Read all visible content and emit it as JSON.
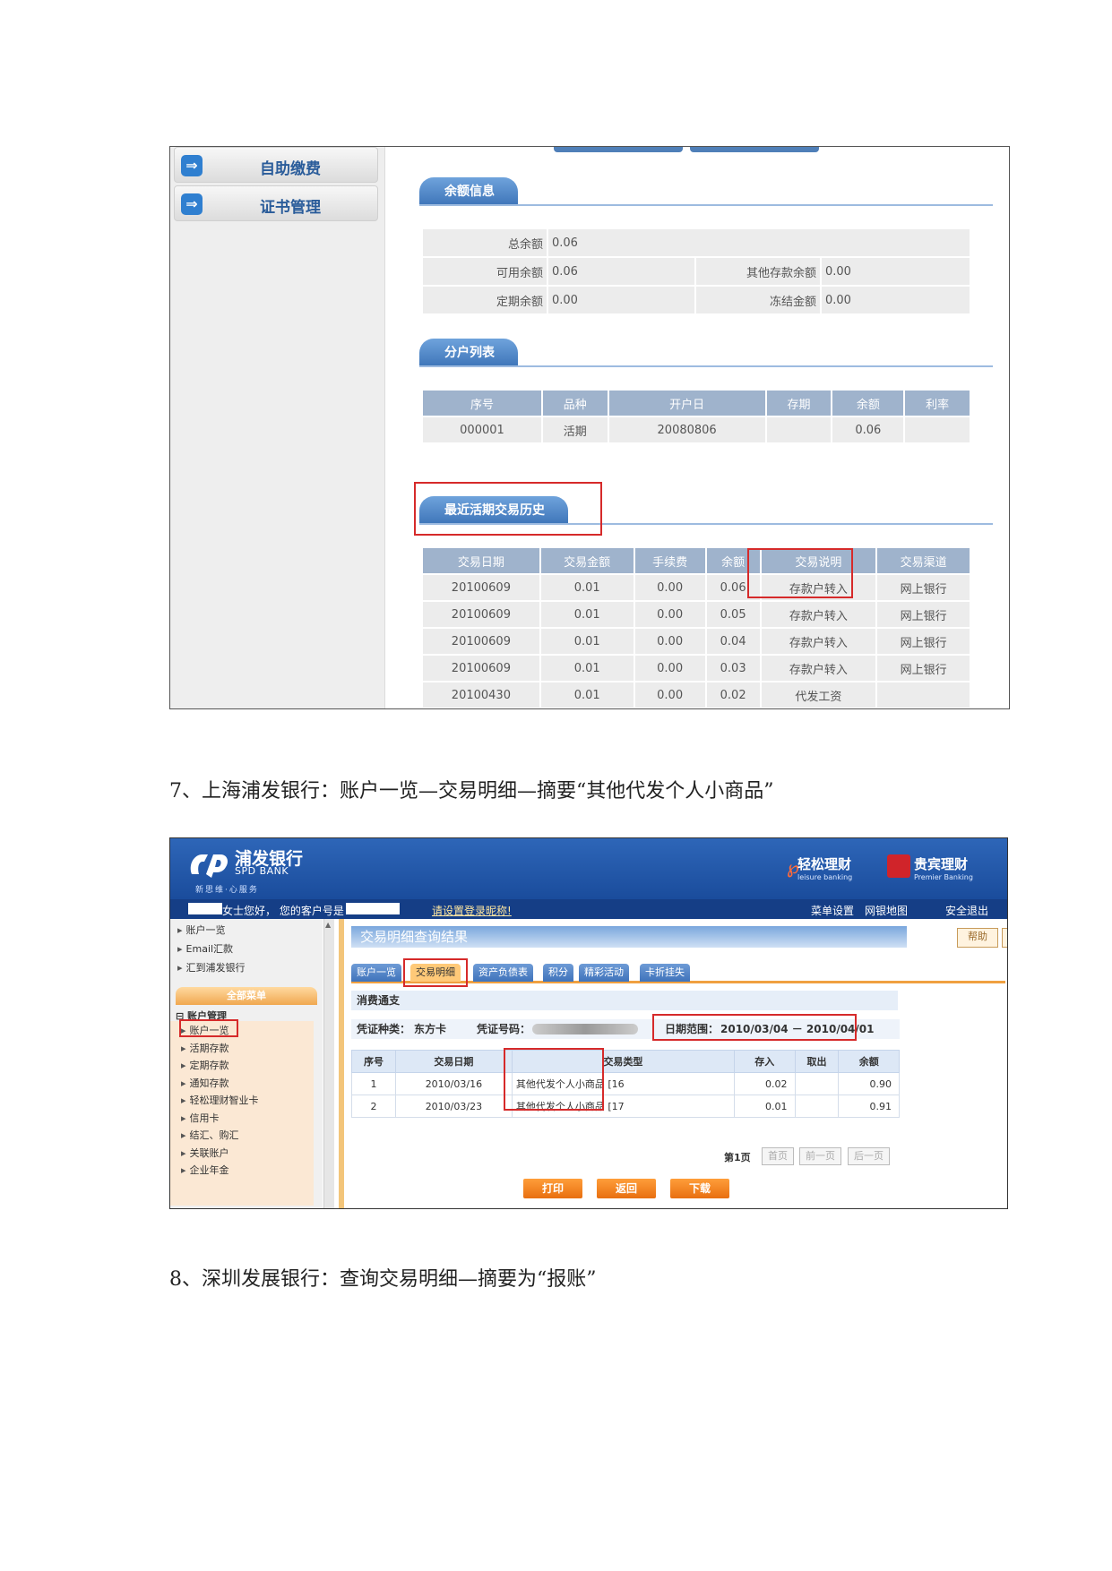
{
  "screenshot1": {
    "menu": [
      "自助缴费",
      "证书管理"
    ],
    "balance": {
      "title": "余额信息",
      "rows": [
        [
          {
            "k": "总余额",
            "v": "0.06"
          }
        ],
        [
          {
            "k": "可用余额",
            "v": "0.06"
          },
          {
            "k": "其他存款余额",
            "v": "0.00"
          }
        ],
        [
          {
            "k": "定期余额",
            "v": "0.00"
          },
          {
            "k": "冻结金额",
            "v": "0.00"
          }
        ]
      ]
    },
    "subaccounts": {
      "title": "分户列表",
      "headers": [
        "序号",
        "品种",
        "开户日",
        "存期",
        "余额",
        "利率"
      ],
      "rows": [
        [
          "000001",
          "活期",
          "20080806",
          "",
          "0.06",
          ""
        ]
      ]
    },
    "history": {
      "title": "最近活期交易历史",
      "headers": [
        "交易日期",
        "交易金额",
        "手续费",
        "余额",
        "交易说明",
        "交易渠道"
      ],
      "rows": [
        [
          "20100609",
          "0.01",
          "0.00",
          "0.06",
          "存款户转入",
          "网上银行"
        ],
        [
          "20100609",
          "0.01",
          "0.00",
          "0.05",
          "存款户转入",
          "网上银行"
        ],
        [
          "20100609",
          "0.01",
          "0.00",
          "0.04",
          "存款户转入",
          "网上银行"
        ],
        [
          "20100609",
          "0.01",
          "0.00",
          "0.03",
          "存款户转入",
          "网上银行"
        ],
        [
          "20100430",
          "0.01",
          "0.00",
          "0.02",
          "代发工资",
          ""
        ]
      ]
    }
  },
  "caption7": "7、上海浦发银行：账户一览—交易明细—摘要“其他代发个人小商品”",
  "screenshot2": {
    "logo_cn": "浦发银行",
    "logo_en": "SPD BANK",
    "logo_sub": "新思维·心服务",
    "brand1": "轻松理财",
    "brand1_en": "leisure banking",
    "brand2": "贵宾理财",
    "brand2_en": "Premier Banking",
    "greeting": "女士您好，   您的客户号是",
    "greeting_link": "请设置登录昵称!",
    "top_links": [
      "菜单设置",
      "网银地图",
      "安全退出"
    ],
    "side_top": [
      "账户一览",
      "Email汇款",
      "汇到浦发银行"
    ],
    "side_all": "全部菜单",
    "side_group": "账户管理",
    "side_items": [
      "账户一览",
      "活期存款",
      "定期存款",
      "通知存款",
      "轻松理财智业卡",
      "信用卡",
      "结汇、购汇",
      "关联账户",
      "企业年金"
    ],
    "page_title": "交易明细查询结果",
    "help_label": "帮助",
    "back_label": "返回",
    "tabs": [
      "账户一览",
      "交易明细",
      "资产负债表",
      "积分",
      "精彩活动",
      "卡折挂失"
    ],
    "card_name": "消费通支",
    "voucher_type_label": "凭证种类：",
    "voucher_type": "东方卡",
    "voucher_no_label": "凭证号码：",
    "date_range_label": "日期范围：",
    "date_range": "2010/03/04 － 2010/04/01",
    "table_headers": [
      "序号",
      "交易日期",
      "交易类型",
      "存入",
      "取出",
      "余额"
    ],
    "table_rows": [
      [
        "1",
        "2010/03/16",
        "其他代发个人小商品 [16",
        "0.02",
        "",
        "0.90"
      ],
      [
        "2",
        "2010/03/23",
        "其他代发个人小商品 [17",
        "0.01",
        "",
        "0.91"
      ]
    ],
    "page_info": "第1页",
    "pager": [
      "首页",
      "前一页",
      "后一页"
    ],
    "actions": [
      "打印",
      "返回",
      "下载"
    ]
  },
  "caption8": "8、深圳发展银行：查询交易明细—摘要为“报账”",
  "colors": {
    "accent_blue": "#3d74b8",
    "highlight_red": "#d62a2a",
    "orange": "#e86f10"
  }
}
